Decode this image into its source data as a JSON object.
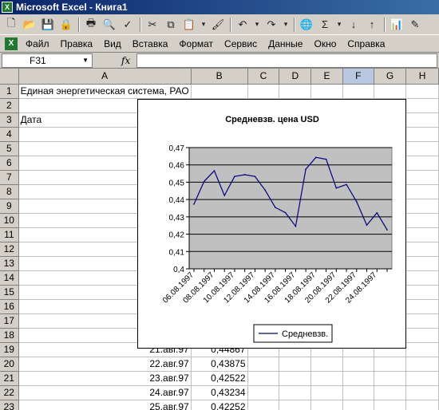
{
  "window": {
    "title": "Microsoft Excel - Книга1",
    "app_icon": "excel-icon"
  },
  "toolbar": {
    "buttons": [
      "new-icon",
      "open-icon",
      "save-icon",
      "permission-icon",
      "print-icon",
      "print-preview-icon",
      "spelling-icon",
      "cut-icon",
      "copy-icon",
      "paste-icon",
      "format-painter-icon",
      "undo-icon",
      "redo-icon",
      "hyperlink-icon",
      "autosum-icon",
      "sort-ascending-icon",
      "sort-descending-icon",
      "chart-wizard-icon",
      "drawing-icon"
    ]
  },
  "menu": [
    "Файл",
    "Правка",
    "Вид",
    "Вставка",
    "Формат",
    "Сервис",
    "Данные",
    "Окно",
    "Справка"
  ],
  "formula_bar": {
    "name_box": "F31",
    "fx": "fx",
    "content": ""
  },
  "columns": [
    "A",
    "B",
    "C",
    "D",
    "E",
    "F",
    "G",
    "H"
  ],
  "selected_column": "F",
  "rows": [
    {
      "n": "1",
      "a": "Единая энергетическая система, РАО",
      "b": ""
    },
    {
      "n": "2",
      "a": "",
      "b": "Средневзв."
    },
    {
      "n": "3",
      "a": "Дата",
      "b": "цена, USD"
    },
    {
      "n": "4",
      "a": "06.авг.97",
      "b": "0,43733"
    },
    {
      "n": "5",
      "a": "07.авг.97",
      "b": "0,45046"
    },
    {
      "n": "6",
      "a": "08.авг.97",
      "b": "0,45659"
    },
    {
      "n": "7",
      "a": "09.авг.97",
      "b": "0,44234"
    },
    {
      "n": "8",
      "a": "10.авг.97",
      "b": "0,45334"
    },
    {
      "n": "9",
      "a": "11.авг.97",
      "b": "0,45435"
    },
    {
      "n": "10",
      "a": "12.авг.97",
      "b": "0,45332"
    },
    {
      "n": "11",
      "a": "13.авг.97",
      "b": "0,44543"
    },
    {
      "n": "12",
      "a": "14.авг.97",
      "b": "0,43543"
    },
    {
      "n": "13",
      "a": "15.авг.97",
      "b": "0,43243"
    },
    {
      "n": "14",
      "a": "16.авг.97",
      "b": "0,42453"
    },
    {
      "n": "15",
      "a": "17.авг.97",
      "b": "0,45753"
    },
    {
      "n": "16",
      "a": "18.авг.97",
      "b": "0,46432"
    },
    {
      "n": "17",
      "a": "19.авг.97",
      "b": "0,46324"
    },
    {
      "n": "18",
      "a": "20.авг.97",
      "b": "0,44665"
    },
    {
      "n": "19",
      "a": "21.авг.97",
      "b": "0,44867"
    },
    {
      "n": "20",
      "a": "22.авг.97",
      "b": "0,43875"
    },
    {
      "n": "21",
      "a": "23.авг.97",
      "b": "0,42522"
    },
    {
      "n": "22",
      "a": "24.авг.97",
      "b": "0,43234"
    },
    {
      "n": "23",
      "a": "25.авг.97",
      "b": "0,42252"
    },
    {
      "n": "24",
      "a": "",
      "b": ""
    }
  ],
  "chart_data": {
    "type": "line",
    "title": "Средневзв. цена USD",
    "x": [
      "06.08.1997",
      "07.08.1997",
      "08.08.1997",
      "09.08.1997",
      "10.08.1997",
      "11.08.1997",
      "12.08.1997",
      "13.08.1997",
      "14.08.1997",
      "15.08.1997",
      "16.08.1997",
      "17.08.1997",
      "18.08.1997",
      "19.08.1997",
      "20.08.1997",
      "21.08.1997",
      "22.08.1997",
      "23.08.1997",
      "24.08.1997",
      "25.08.1997"
    ],
    "x_tick_labels": [
      "06.08.1997",
      "08.08.1997",
      "10.08.1997",
      "12.08.1997",
      "14.08.1997",
      "16.08.1997",
      "18.08.1997",
      "20.08.1997",
      "22.08.1997",
      "24.08.1997"
    ],
    "series": [
      {
        "name": "Средневзв.",
        "values": [
          0.43733,
          0.45046,
          0.45659,
          0.44234,
          0.45334,
          0.45435,
          0.45332,
          0.44543,
          0.43543,
          0.43243,
          0.42453,
          0.45753,
          0.46432,
          0.46324,
          0.44665,
          0.44867,
          0.43875,
          0.42522,
          0.43234,
          0.42252
        ]
      }
    ],
    "y_ticks": [
      "0,4",
      "0,41",
      "0,42",
      "0,43",
      "0,44",
      "0,45",
      "0,46",
      "0,47"
    ],
    "ylim": [
      0.4,
      0.47
    ],
    "grid": true,
    "legend": "bottom",
    "line_color": "#000080",
    "plot_bg": "#c0c0c0"
  }
}
